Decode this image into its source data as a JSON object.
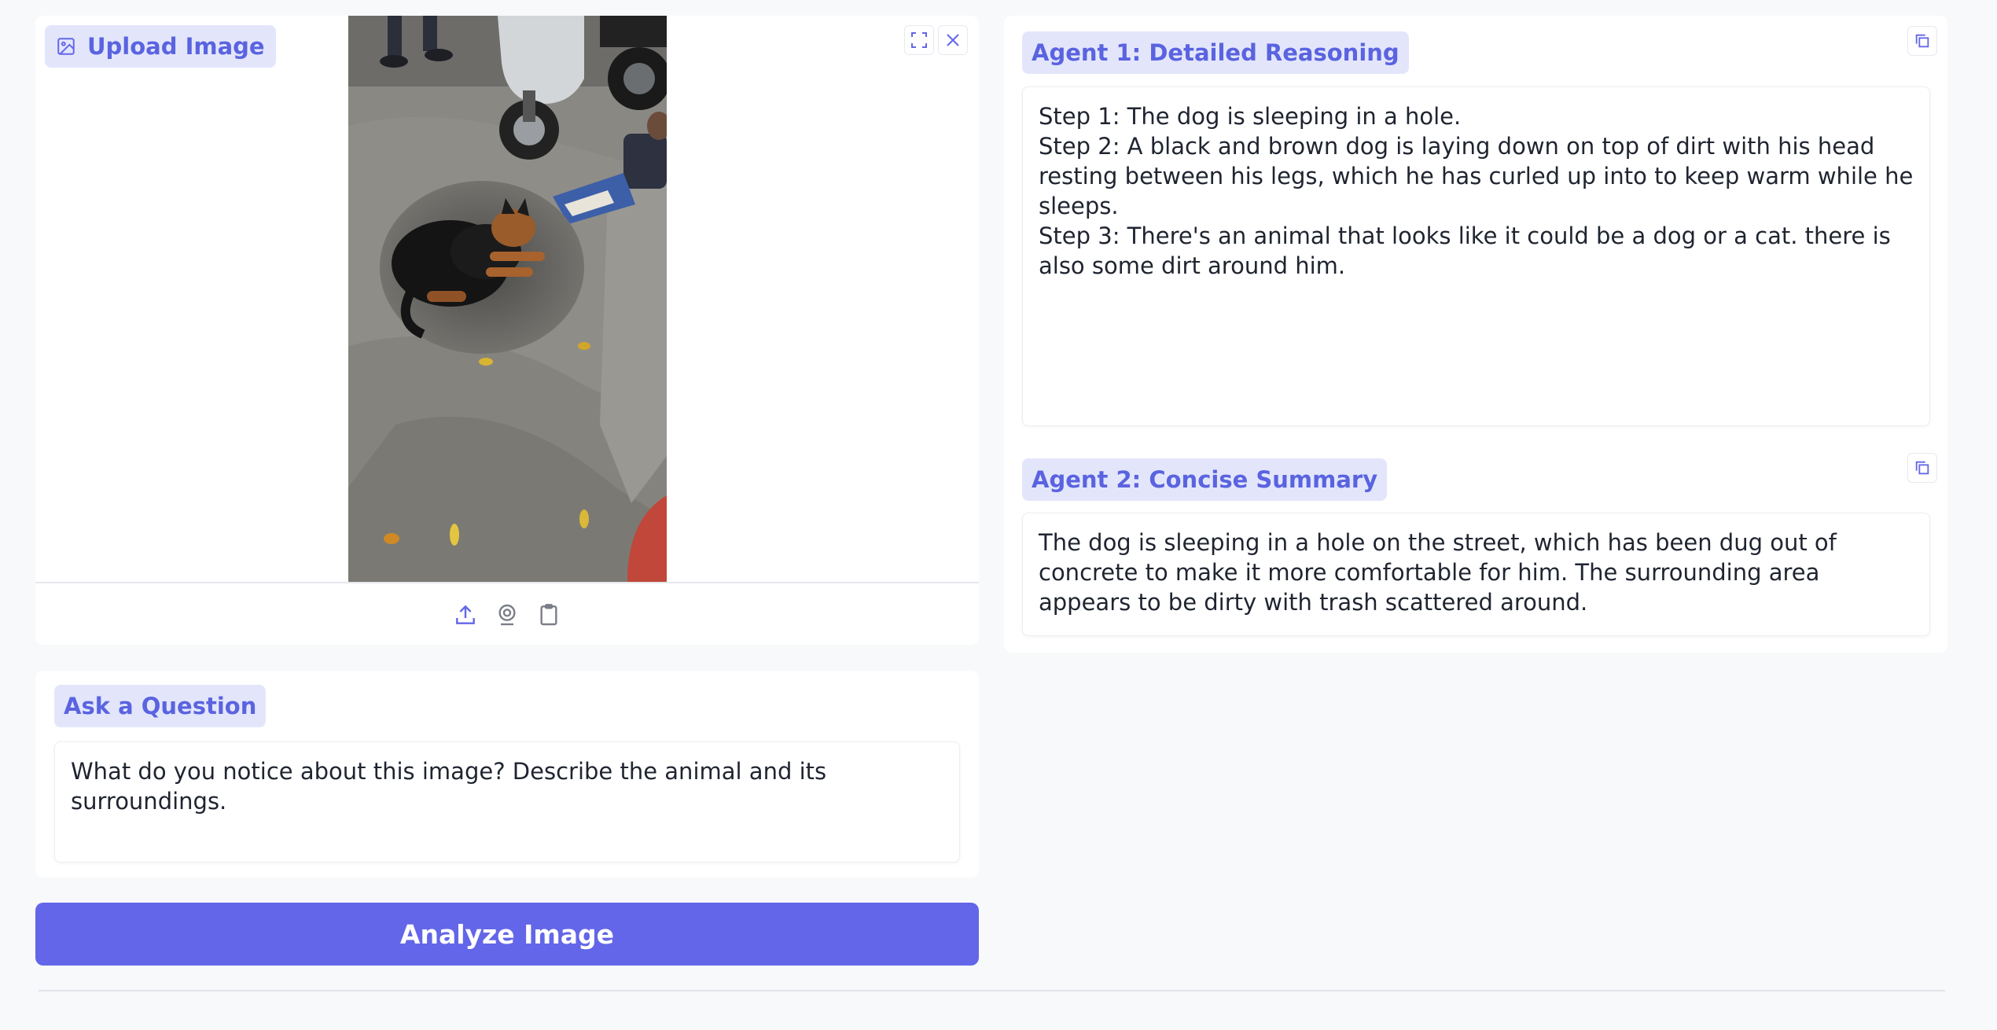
{
  "upload": {
    "label": "Upload Image",
    "image_alt": "Photo of a black and brown dog sleeping in a dug-out hole in the dirt on a street, with parked scooters above"
  },
  "toolbar": {
    "fullscreen_icon": "fullscreen-icon",
    "close_icon": "close-icon",
    "upload_icon": "upload-icon",
    "webcam_icon": "webcam-icon",
    "clipboard_icon": "clipboard-icon"
  },
  "question": {
    "label": "Ask a Question",
    "value": "What do you notice about this image? Describe the animal and its surroundings."
  },
  "analyze_button": {
    "label": "Analyze Image"
  },
  "agent1": {
    "label": "Agent 1: Detailed Reasoning",
    "text": "Step 1: The dog is sleeping in a hole.\nStep 2: A black and brown dog is laying down on top of dirt with his head resting between his legs, which he has curled up into to keep warm while he sleeps.\nStep 3: There's an animal that looks like it could be a dog or a cat. there is also some dirt around him."
  },
  "agent2": {
    "label": "Agent 2: Concise Summary",
    "text": "The dog is sleeping in a hole on the street, which has been dug out of concrete to make it more comfortable for him. The surrounding area appears to be dirty with trash scattered around."
  },
  "colors": {
    "accent": "#6366e8",
    "chip_bg": "#e3e6fb",
    "chip_text": "#5a63e0",
    "background": "#f8f9fb"
  }
}
